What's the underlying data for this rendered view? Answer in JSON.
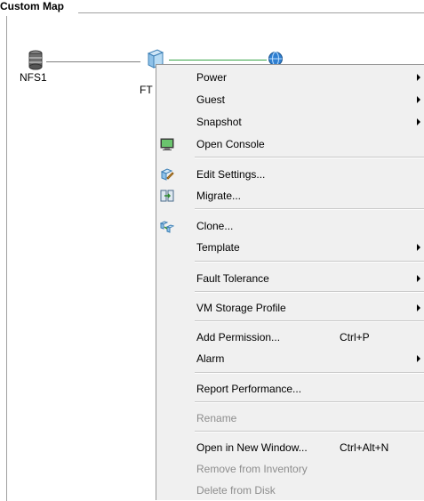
{
  "map": {
    "title": "Custom Map",
    "nodes": {
      "datastore_label": "NFS1",
      "vm_label": "FT"
    }
  },
  "menu": {
    "items": {
      "power": "Power",
      "guest": "Guest",
      "snapshot": "Snapshot",
      "open_console": "Open Console",
      "edit_settings": "Edit Settings...",
      "migrate": "Migrate...",
      "clone": "Clone...",
      "template": "Template",
      "fault_tolerance": "Fault Tolerance",
      "vm_storage_profile": "VM Storage Profile",
      "add_permission": "Add Permission...",
      "add_permission_shortcut": "Ctrl+P",
      "alarm": "Alarm",
      "report_performance": "Report Performance...",
      "rename": "Rename",
      "open_new_window": "Open in New Window...",
      "open_new_window_shortcut": "Ctrl+Alt+N",
      "remove_inventory": "Remove from Inventory",
      "delete_disk": "Delete from Disk"
    }
  },
  "colors": {
    "menu_background": "#f0f0f0",
    "disabled_text": "#8d8d8d",
    "network_edge": "#3aa548",
    "storage_edge": "#808080"
  },
  "icons": {
    "datastore": "database-icon",
    "vm": "virtual-machine-icon",
    "network": "network-globe-icon",
    "open_console": "console-icon",
    "edit_settings": "edit-settings-icon",
    "migrate": "migrate-icon",
    "clone": "clone-icon"
  }
}
